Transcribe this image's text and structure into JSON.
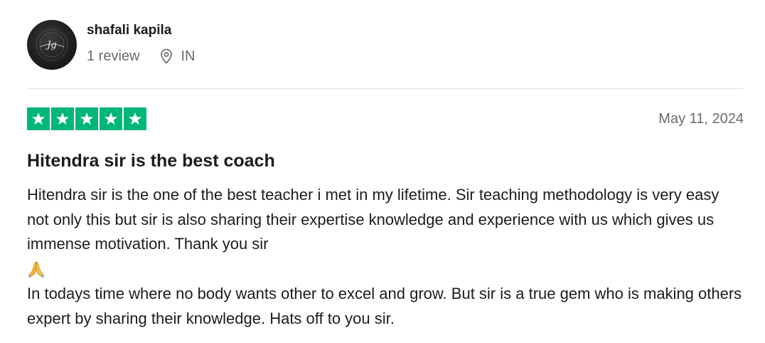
{
  "reviewer": {
    "name": "shafali kapila",
    "avatar_initials": "Jg",
    "review_count": "1 review",
    "location_icon": "location-pin-icon",
    "country": "IN"
  },
  "review": {
    "rating": 5,
    "rating_max": 5,
    "star_color": "#00b67a",
    "date": "May 11, 2024",
    "title": "Hitendra sir is the best coach",
    "paragraph_1": "Hitendra sir is the one of the best teacher i met in my lifetime. Sir teaching methodology is very easy not only this but sir is also sharing their expertise knowledge and experience with us which gives us immense motivation. Thank you sir",
    "emoji_icon": "folded-hands-icon",
    "paragraph_2": "In todays time where no body wants other to excel and grow. But sir is a true gem who is making others expert by sharing their knowledge. Hats off to you sir."
  }
}
